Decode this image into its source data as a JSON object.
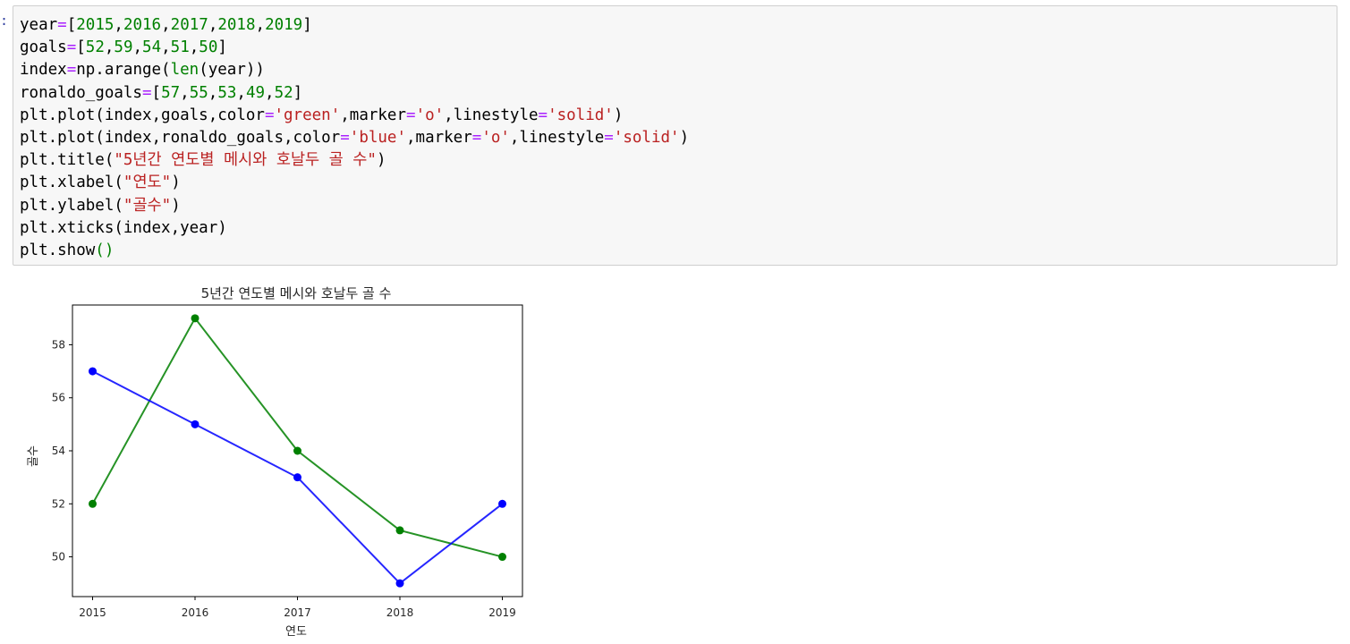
{
  "prompt_marker": ":",
  "code_lines": [
    [
      {
        "t": "year"
      },
      {
        "t": "=",
        "c": "op"
      },
      {
        "t": "["
      },
      {
        "t": "2015",
        "c": "num"
      },
      {
        "t": ","
      },
      {
        "t": "2016",
        "c": "num"
      },
      {
        "t": ","
      },
      {
        "t": "2017",
        "c": "num"
      },
      {
        "t": ","
      },
      {
        "t": "2018",
        "c": "num"
      },
      {
        "t": ","
      },
      {
        "t": "2019",
        "c": "num"
      },
      {
        "t": "]"
      }
    ],
    [
      {
        "t": "goals"
      },
      {
        "t": "=",
        "c": "op"
      },
      {
        "t": "["
      },
      {
        "t": "52",
        "c": "num"
      },
      {
        "t": ","
      },
      {
        "t": "59",
        "c": "num"
      },
      {
        "t": ","
      },
      {
        "t": "54",
        "c": "num"
      },
      {
        "t": ","
      },
      {
        "t": "51",
        "c": "num"
      },
      {
        "t": ","
      },
      {
        "t": "50",
        "c": "num"
      },
      {
        "t": "]"
      }
    ],
    [
      {
        "t": "index"
      },
      {
        "t": "=",
        "c": "op"
      },
      {
        "t": "np.arange("
      },
      {
        "t": "len",
        "c": "bi"
      },
      {
        "t": "(year))"
      }
    ],
    [
      {
        "t": "ronaldo_goals"
      },
      {
        "t": "=",
        "c": "op"
      },
      {
        "t": "["
      },
      {
        "t": "57",
        "c": "num"
      },
      {
        "t": ","
      },
      {
        "t": "55",
        "c": "num"
      },
      {
        "t": ","
      },
      {
        "t": "53",
        "c": "num"
      },
      {
        "t": ","
      },
      {
        "t": "49",
        "c": "num"
      },
      {
        "t": ","
      },
      {
        "t": "52",
        "c": "num"
      },
      {
        "t": "]"
      }
    ],
    [
      {
        "t": "plt.plot(index,goals,color"
      },
      {
        "t": "=",
        "c": "op"
      },
      {
        "t": "'green'",
        "c": "str"
      },
      {
        "t": ",marker"
      },
      {
        "t": "=",
        "c": "op"
      },
      {
        "t": "'o'",
        "c": "str"
      },
      {
        "t": ",linestyle"
      },
      {
        "t": "=",
        "c": "op"
      },
      {
        "t": "'solid'",
        "c": "str"
      },
      {
        "t": ")"
      }
    ],
    [
      {
        "t": "plt.plot(index,ronaldo_goals,color"
      },
      {
        "t": "=",
        "c": "op"
      },
      {
        "t": "'blue'",
        "c": "str"
      },
      {
        "t": ",marker"
      },
      {
        "t": "=",
        "c": "op"
      },
      {
        "t": "'o'",
        "c": "str"
      },
      {
        "t": ",linestyle"
      },
      {
        "t": "=",
        "c": "op"
      },
      {
        "t": "'solid'",
        "c": "str"
      },
      {
        "t": ")"
      }
    ],
    [
      {
        "t": "plt.title("
      },
      {
        "t": "\"5년간 연도별 메시와 호날두 골 수\"",
        "c": "str"
      },
      {
        "t": ")"
      }
    ],
    [
      {
        "t": "plt.xlabel("
      },
      {
        "t": "\"연도\"",
        "c": "str"
      },
      {
        "t": ")"
      }
    ],
    [
      {
        "t": "plt.ylabel("
      },
      {
        "t": "\"골수\"",
        "c": "str"
      },
      {
        "t": ")"
      }
    ],
    [
      {
        "t": "plt.xticks(index,year)"
      }
    ],
    [
      {
        "t": "plt.show"
      },
      {
        "t": "()",
        "c": "paren"
      }
    ]
  ],
  "colors": {
    "cell_bg": "#f7f7f7",
    "cell_border": "#cfcfcf",
    "operator": "#aa22ff",
    "number": "#008000",
    "string": "#ba2121",
    "builtin": "#008000"
  },
  "chart_data": {
    "type": "line",
    "title": "5년간 연도별 메시와 호날두 골 수",
    "xlabel": "연도",
    "ylabel": "골수",
    "categories": [
      "2015",
      "2016",
      "2017",
      "2018",
      "2019"
    ],
    "yticks": [
      50,
      52,
      54,
      56,
      58
    ],
    "ylim": [
      48.5,
      59.5
    ],
    "grid": false,
    "series": [
      {
        "key": "goals",
        "color": "green",
        "marker": "o",
        "values": [
          52,
          59,
          54,
          51,
          50
        ]
      },
      {
        "key": "ronaldo_goals",
        "color": "blue",
        "marker": "o",
        "values": [
          57,
          55,
          53,
          49,
          52
        ]
      }
    ]
  }
}
